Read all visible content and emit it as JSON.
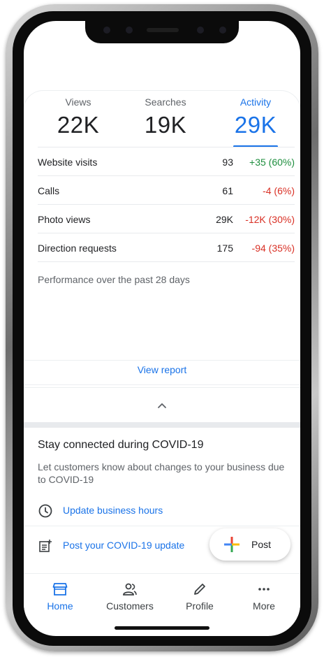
{
  "stats": [
    {
      "label": "Views",
      "value": "22K",
      "active": false
    },
    {
      "label": "Searches",
      "value": "19K",
      "active": false
    },
    {
      "label": "Activity",
      "value": "29K",
      "active": true
    }
  ],
  "metrics": [
    {
      "name": "Website visits",
      "value": "93",
      "change": "+35 (60%)",
      "trend": "up"
    },
    {
      "name": "Calls",
      "value": "61",
      "change": "-4 (6%)",
      "trend": "down"
    },
    {
      "name": "Photo views",
      "value": "29K",
      "change": "-12K (30%)",
      "trend": "down"
    },
    {
      "name": "Direction requests",
      "value": "175",
      "change": "-94 (35%)",
      "trend": "down"
    }
  ],
  "performance_note": "Performance over the past 28 days",
  "view_report_label": "View report",
  "covid": {
    "title": "Stay connected during COVID-19",
    "description": "Let customers know about changes to your business due to COVID-19",
    "update_hours_label": "Update business hours",
    "post_update_label": "Post your COVID-19 update"
  },
  "fab": {
    "label": "Post",
    "icon": "plus-multicolor-icon"
  },
  "nav": [
    {
      "label": "Home",
      "icon": "storefront-icon",
      "active": true
    },
    {
      "label": "Customers",
      "icon": "people-icon",
      "active": false
    },
    {
      "label": "Profile",
      "icon": "pencil-icon",
      "active": false
    },
    {
      "label": "More",
      "icon": "more-horizontal-icon",
      "active": false
    }
  ],
  "colors": {
    "accent": "#1a73e8",
    "positive": "#1e8e3e",
    "negative": "#d93025"
  }
}
